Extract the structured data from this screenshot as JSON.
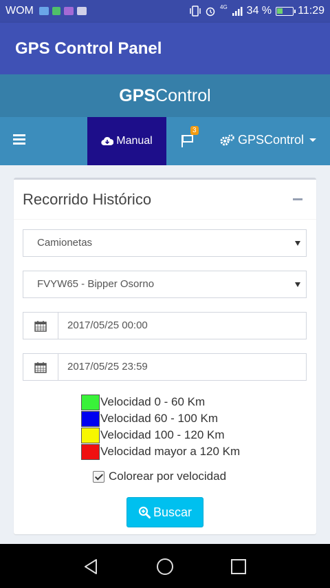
{
  "status_bar": {
    "carrier": "WOM",
    "network": "4G",
    "battery": "34 %",
    "time": "11:29"
  },
  "app_bar": {
    "title": "GPS Control Panel"
  },
  "brand": {
    "bold": "GPS",
    "light": "Control"
  },
  "nav": {
    "manual_label": "Manual",
    "flag_badge": "3",
    "gps_menu_label": "GPSControl"
  },
  "box": {
    "title": "Recorrido Histórico",
    "vehicle_type": "Camionetas",
    "vehicle": "FVYW65 - Bipper Osorno",
    "date_from": "2017/05/25 00:00",
    "date_to": "2017/05/25 23:59",
    "legend": [
      {
        "label": "Velocidad 0 - 60 Km",
        "color": "#39f239"
      },
      {
        "label": "Velocidad 60 - 100 Km",
        "color": "#0000f0"
      },
      {
        "label": "Velocidad 100 - 120 Km",
        "color": "#f7f700"
      },
      {
        "label": "Velocidad mayor a 120 Km",
        "color": "#f01010"
      }
    ],
    "color_by_speed_label": "Colorear por velocidad",
    "color_by_speed_checked": true,
    "search_label": "Buscar"
  }
}
